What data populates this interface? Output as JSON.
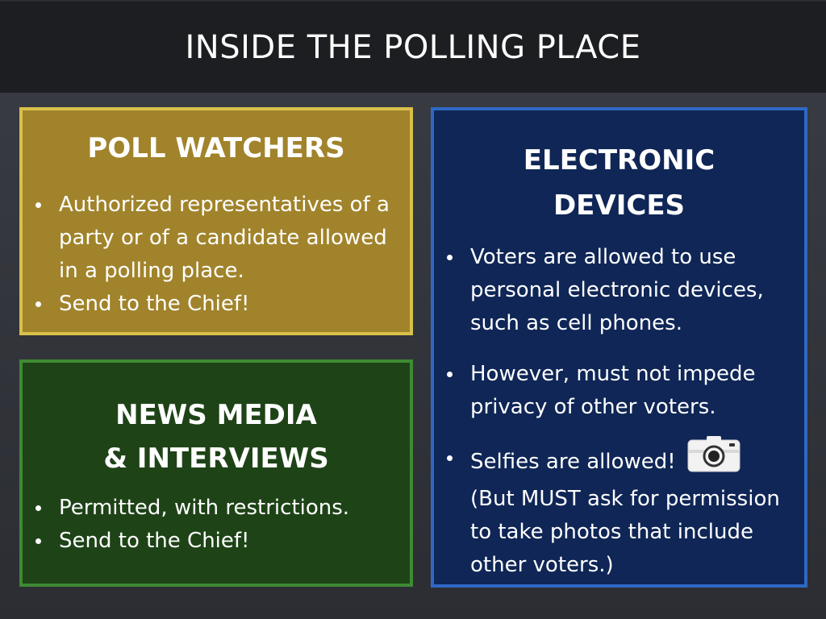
{
  "title": "INSIDE THE POLLING PLACE",
  "poll_watchers": {
    "heading": "POLL WATCHERS",
    "bullets": [
      "Authorized representatives of a party or of a candidate allowed in a polling place.",
      "Send to the Chief!"
    ]
  },
  "news_media": {
    "heading_line1": "NEWS MEDIA",
    "heading_line2": "& INTERVIEWS",
    "bullets": [
      "Permitted, with restrictions.",
      "Send to the Chief!"
    ]
  },
  "electronic_devices": {
    "heading_line1": "ELECTRONIC",
    "heading_line2": "DEVICES",
    "bullets": [
      "Voters are allowed to use personal electronic devices, such as cell phones.",
      "However, must not impede privacy of other voters.",
      "Selfies are allowed!",
      "(But MUST ask for permission to take photos that include other voters.)"
    ],
    "icon": "camera-icon"
  },
  "colors": {
    "title_bar": "#1d1e21",
    "poll_fill": "#a1832b",
    "poll_border": "#d9c04b",
    "news_fill": "#1e4317",
    "news_border": "#3e8a33",
    "devices_fill": "#0f2656",
    "devices_border": "#2f68c4"
  }
}
